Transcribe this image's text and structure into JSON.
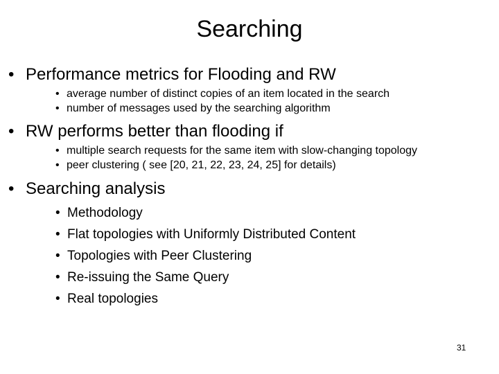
{
  "slide": {
    "title": "Searching",
    "page_number": "31",
    "bullet_glyph": "•",
    "groups": [
      {
        "heading": "Performance metrics for Flooding and RW",
        "sub_size": "small",
        "items": [
          "average number of distinct copies of an item located in the search",
          "number of messages used by the searching algorithm"
        ]
      },
      {
        "heading": "RW performs better than flooding if",
        "sub_size": "small",
        "items": [
          "multiple search requests for the same item with slow-changing topology",
          "peer clustering ( see [20, 21, 22, 23, 24, 25] for details)"
        ]
      },
      {
        "heading": "Searching analysis",
        "sub_size": "big",
        "items": [
          "Methodology",
          "Flat topologies with Uniformly Distributed Content",
          "Topologies with Peer Clustering",
          "Re-issuing the Same Query",
          "Real topologies"
        ]
      }
    ]
  }
}
